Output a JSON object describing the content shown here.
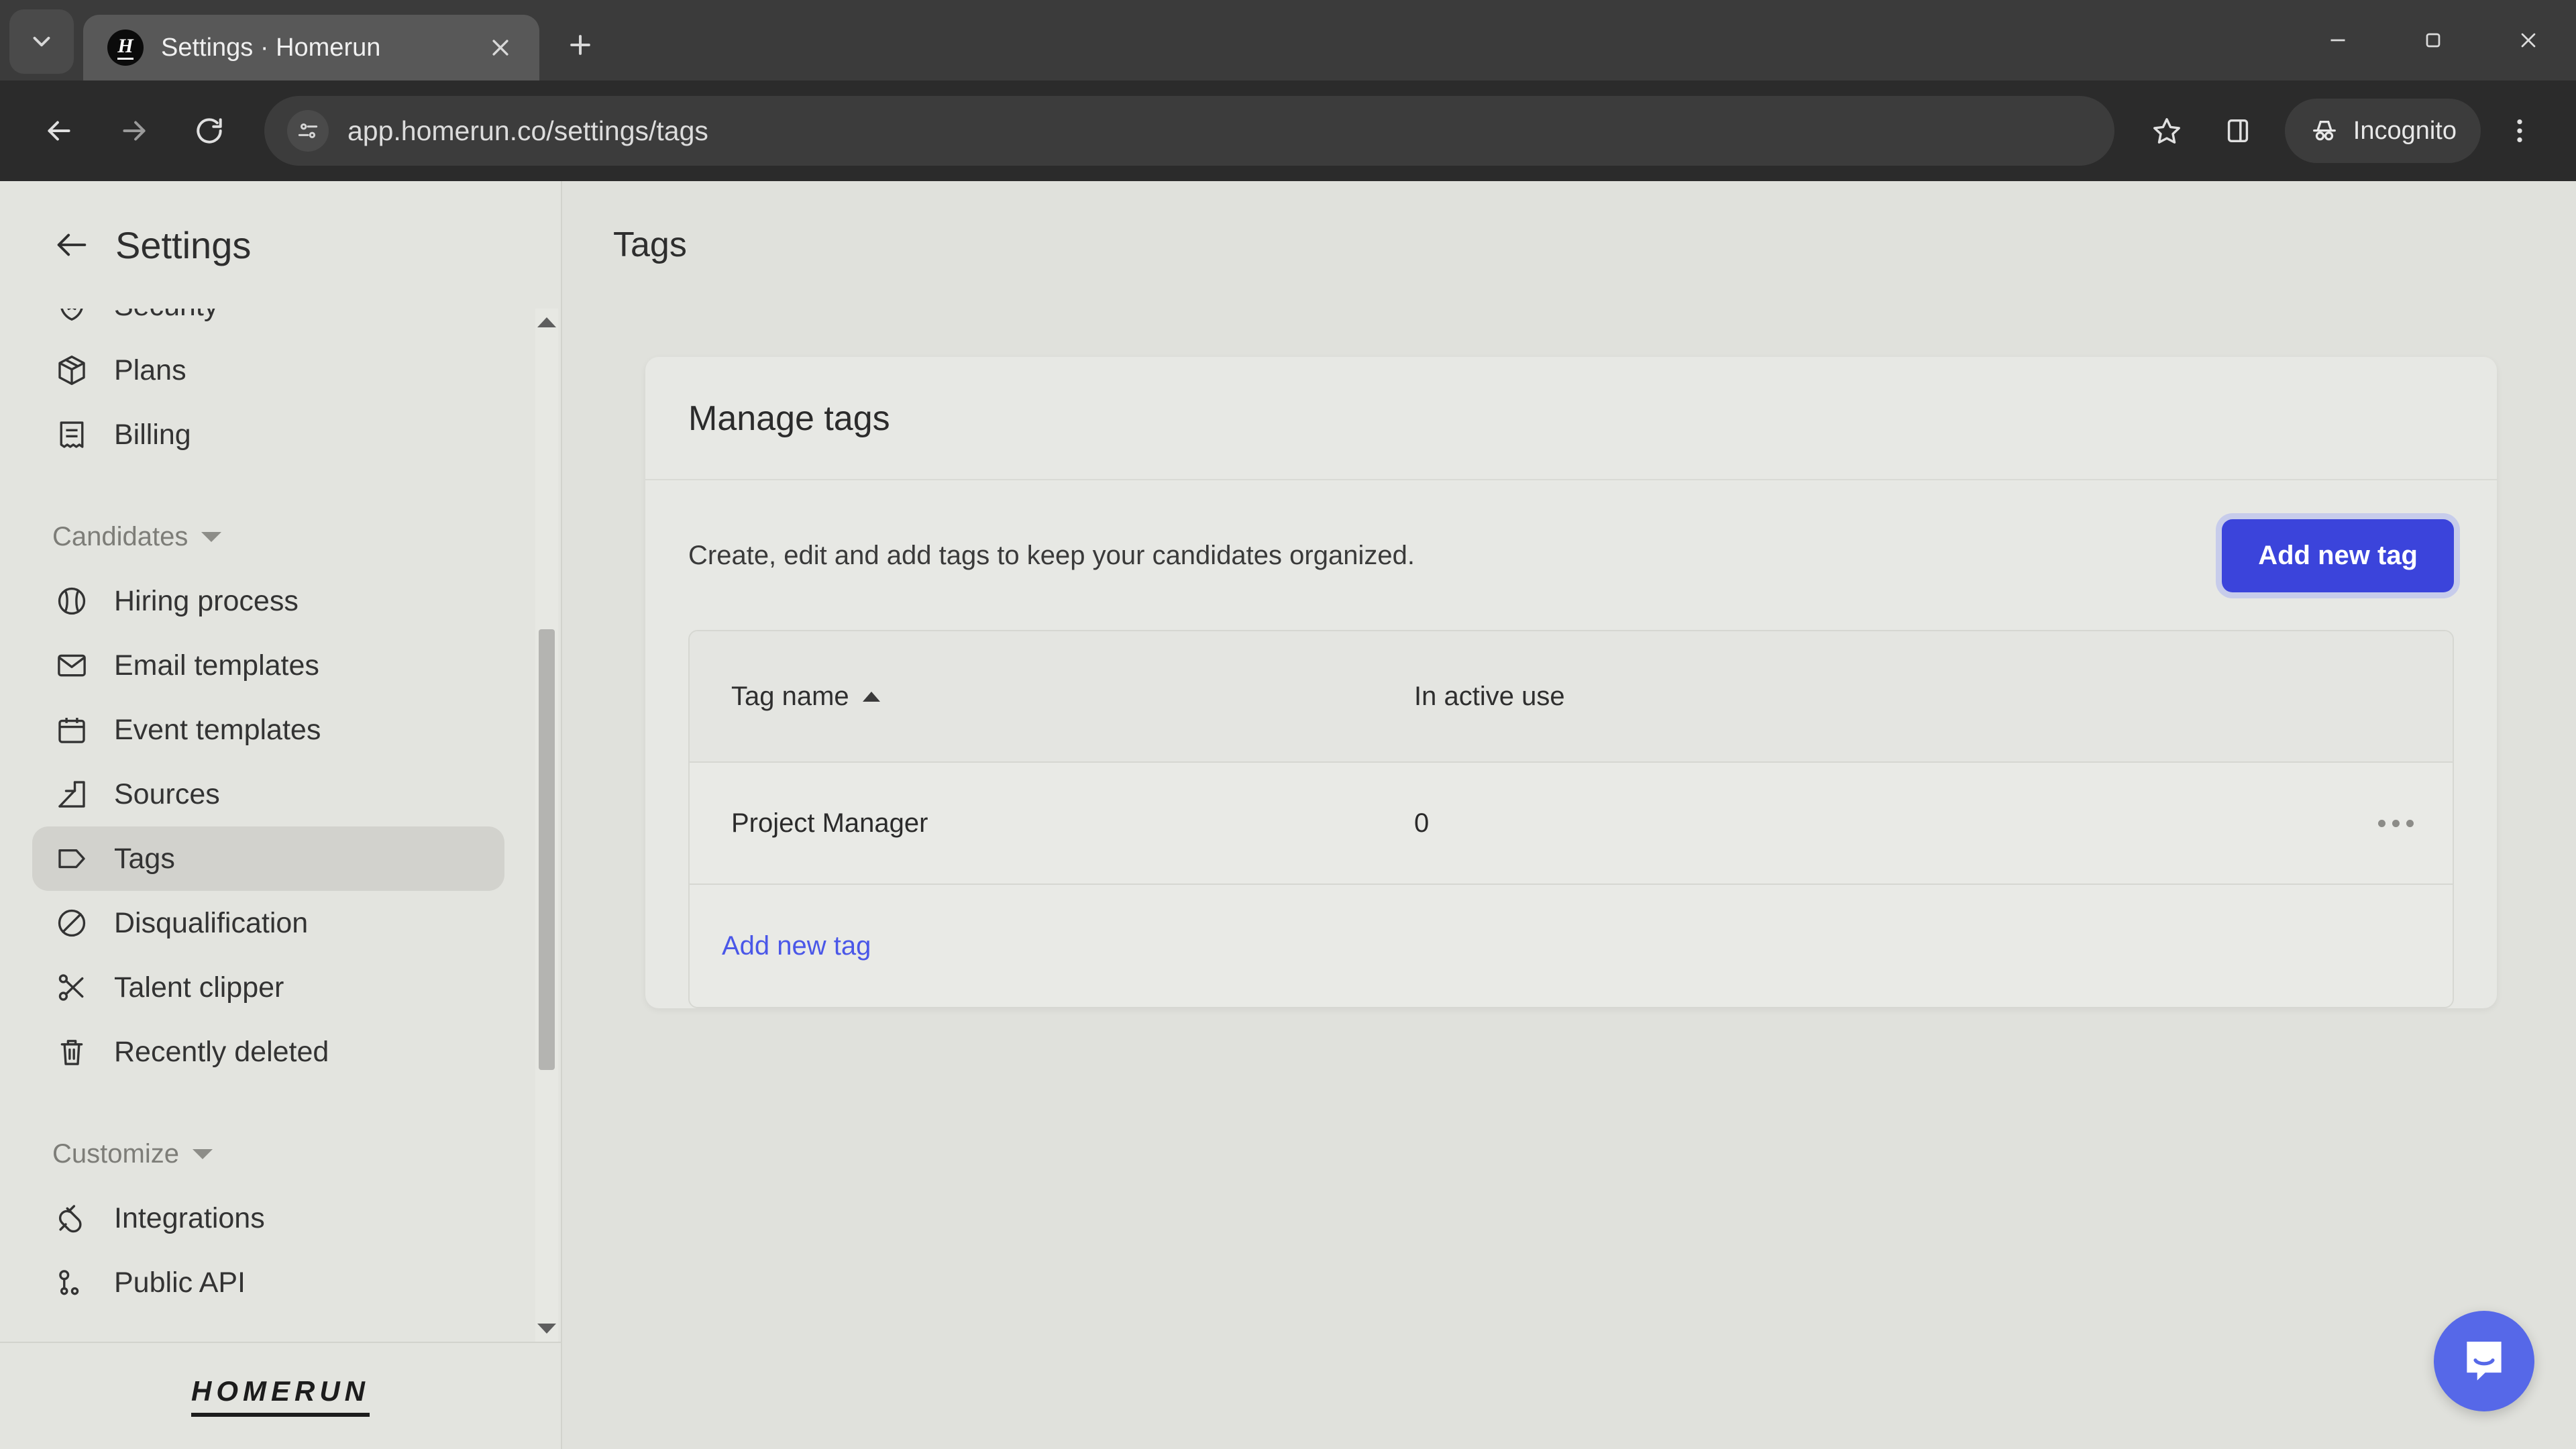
{
  "browser": {
    "tab": {
      "title": "Settings · Homerun",
      "favicon_letter": "H"
    },
    "tab_list_icon": "chevron-down-icon",
    "new_tab_icon": "plus-icon",
    "close_tab_icon": "close-icon",
    "window_controls": [
      "minimize-icon",
      "maximize-icon",
      "close-window-icon"
    ],
    "nav": {
      "back": "back-arrow-icon",
      "forward": "forward-arrow-icon",
      "reload": "reload-icon"
    },
    "omnibox": {
      "url": "app.homerun.co/settings/tags",
      "site_icon": "site-settings-icon"
    },
    "actions": {
      "bookmark": "star-icon",
      "side_panel": "side-panel-icon",
      "menu": "three-dot-menu-icon"
    },
    "incognito": {
      "label": "Incognito",
      "icon": "incognito-hat-icon"
    }
  },
  "sidebar": {
    "title": "Settings",
    "back_icon": "back-arrow-icon",
    "items": [
      {
        "label": "Security",
        "icon": "shield-star-icon",
        "selected": false
      },
      {
        "label": "Plans",
        "icon": "box-icon",
        "selected": false
      },
      {
        "label": "Billing",
        "icon": "receipt-icon",
        "selected": false
      }
    ],
    "groups": [
      {
        "label": "Candidates",
        "items": [
          {
            "label": "Hiring process",
            "icon": "baseball-icon",
            "selected": false
          },
          {
            "label": "Email templates",
            "icon": "envelope-icon",
            "selected": false
          },
          {
            "label": "Event templates",
            "icon": "calendar-icon",
            "selected": false
          },
          {
            "label": "Sources",
            "icon": "arrow-out-box-icon",
            "selected": false
          },
          {
            "label": "Tags",
            "icon": "tag-icon",
            "selected": true
          },
          {
            "label": "Disqualification",
            "icon": "no-entry-icon",
            "selected": false
          },
          {
            "label": "Talent clipper",
            "icon": "scissors-icon",
            "selected": false
          },
          {
            "label": "Recently deleted",
            "icon": "trash-icon",
            "selected": false
          }
        ]
      },
      {
        "label": "Customize",
        "items": [
          {
            "label": "Integrations",
            "icon": "plug-icon",
            "selected": false
          },
          {
            "label": "Public API",
            "icon": "api-key-icon",
            "selected": false
          }
        ]
      }
    ],
    "logo": "HOMERUN"
  },
  "main": {
    "page_title": "Tags",
    "card": {
      "heading": "Manage tags",
      "description": "Create, edit and add tags to keep your candidates organized.",
      "primary_button": "Add new tag"
    },
    "table": {
      "columns": [
        "Tag name",
        "In active use"
      ],
      "sort_column": "Tag name",
      "sort_direction": "asc",
      "rows": [
        {
          "name": "Project Manager",
          "in_active_use": "0",
          "actions_icon": "three-dot-menu-icon"
        }
      ],
      "footer_link": "Add new tag"
    }
  },
  "widgets": {
    "intercom": "chat-bubble-icon"
  },
  "colors": {
    "accent_blue": "#3b44db",
    "link_blue": "#4a57e8",
    "page_bg": "#e0e1dc",
    "card_bg": "#e7e8e4",
    "intercom": "#5668e8"
  }
}
